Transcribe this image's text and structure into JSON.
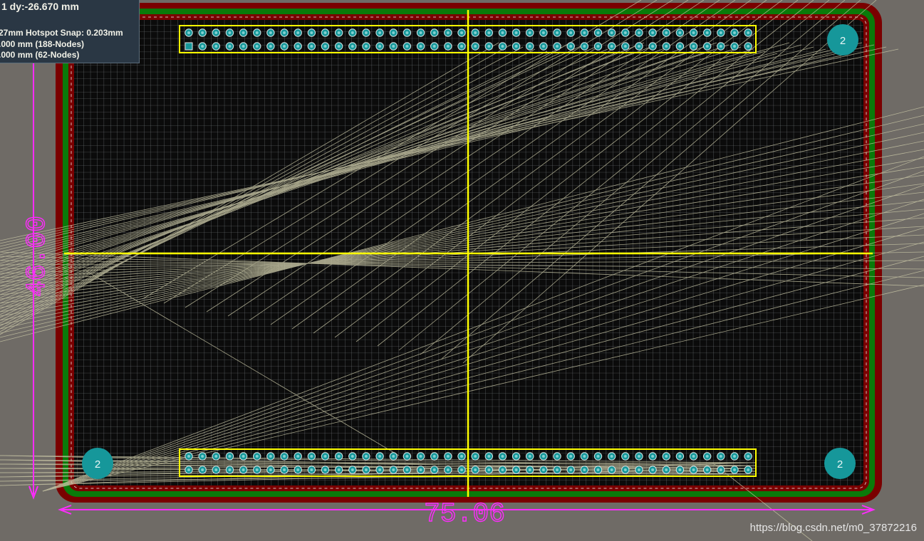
{
  "hud": {
    "line1": "1   dy:-26.670 mm",
    "line2": "27mm Hotspot Snap: 0.203mm",
    "line3": ".000 mm (188-Nodes)",
    "line4": ".000 mm (62-Nodes)"
  },
  "board": {
    "dimension_width": "75.06",
    "dimension_height": "46.00",
    "mounting_hole_label": "2",
    "connector_pins_per_row": 42,
    "connector_rows": 2
  },
  "colors": {
    "background": "#6f6b66",
    "board_fill": "#0b0b0b",
    "grid": "#9aa1a8",
    "keepout": "#7a0000",
    "outline_green": "#0a7a0a",
    "silkscreen": "#ffff00",
    "dimension": "#ff2bff",
    "pad_teal": "#16979a",
    "ratsnest": "#c9c7a6"
  },
  "watermark": "https://blog.csdn.net/m0_37872216"
}
